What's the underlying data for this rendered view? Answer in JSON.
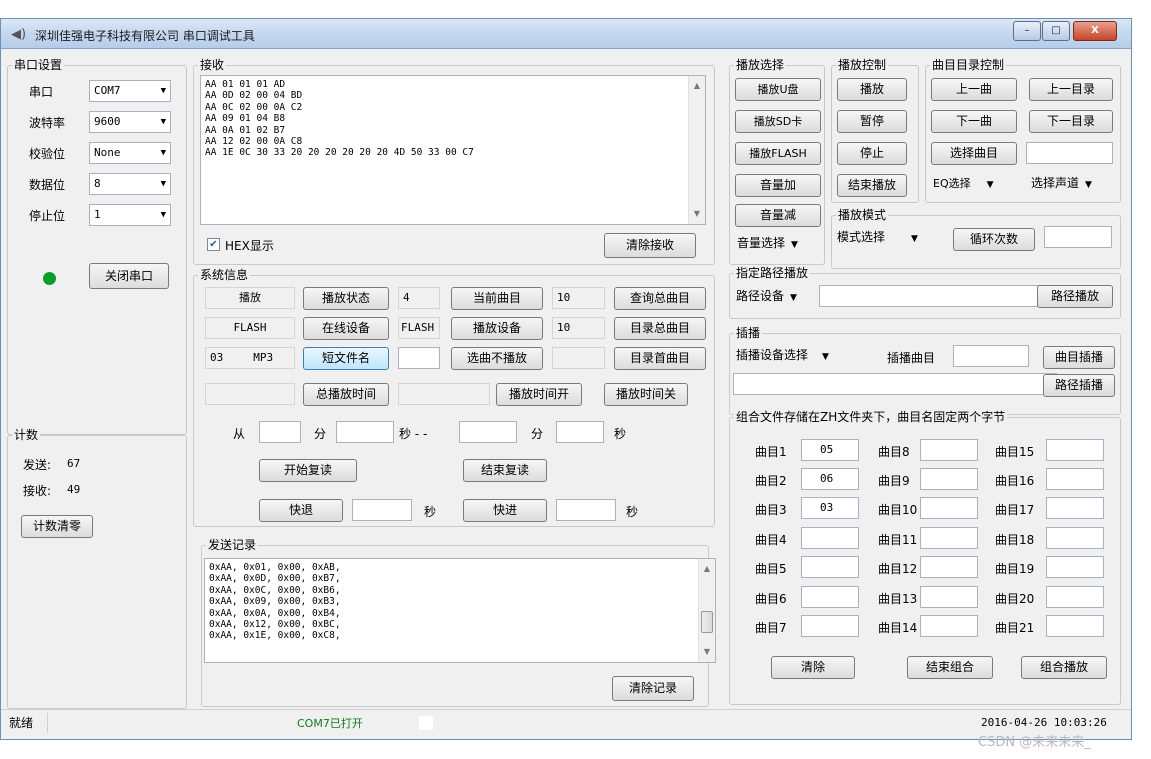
{
  "window": {
    "title": "深圳佳强电子科技有限公司  串口调试工具",
    "min": "–",
    "max": "□",
    "close": "X"
  },
  "serial": {
    "group": "串口设置",
    "port_label": "串口",
    "port_value": "COM7",
    "baud_label": "波特率",
    "baud_value": "9600",
    "parity_label": "校验位",
    "parity_value": "None",
    "data_label": "数据位",
    "data_value": "8",
    "stop_label": "停止位",
    "stop_value": "1",
    "led_color": "#0c9c2c",
    "close_button": "关闭串口"
  },
  "counter": {
    "group": "计数",
    "sent_label": "发送:",
    "sent_value": "67",
    "recv_label": "接收:",
    "recv_value": "49",
    "clear_button": "计数清零"
  },
  "receive": {
    "group": "接收",
    "lines": "AA 01 01 01 AD\nAA 0D 02 00 04 BD\nAA 0C 02 00 0A C2\nAA 09 01 04 B8\nAA 0A 01 02 B7\nAA 12 02 00 0A C8\nAA 1E 0C 30 33 20 20 20 20 20 20 4D 50 33 00 C7",
    "hex_label": "HEX显示",
    "hex_checked": "✔",
    "clear_button": "清除接收"
  },
  "sysinfo": {
    "group": "系统信息",
    "status_value": "播放",
    "status_button": "播放状态",
    "cur_track_value": "4",
    "cur_track_button": "当前曲目",
    "total_value": "10",
    "total_button": "查询总曲目",
    "online_value": "FLASH",
    "online_button": "在线设备",
    "play_dev_value": "FLASH",
    "play_dev_button": "播放设备",
    "dir_total_value": "10",
    "dir_total_button": "目录总曲目",
    "short_name_value_a": "03",
    "short_name_value_b": "MP3",
    "short_name_button": "短文件名",
    "no_play_value": "",
    "no_play_button": "选曲不播放",
    "dir_first_value": "",
    "dir_first_button": "目录首曲目",
    "total_time_value": "",
    "total_time_button": "总播放时间",
    "time_on_value": "",
    "time_on_button": "播放时间开",
    "time_off_button": "播放时间关",
    "from_label": "从",
    "min_label": "分",
    "sec_label": "秒 - -",
    "min2_label": "分",
    "sec2_label": "秒",
    "start_repeat": "开始复读",
    "end_repeat": "结束复读",
    "rewind": "快退",
    "rewind_sec": "秒",
    "forward": "快进",
    "forward_sec": "秒"
  },
  "sendlog": {
    "group": "发送记录",
    "lines": "0xAA, 0x01, 0x00, 0xAB,\n0xAA, 0x0D, 0x00, 0xB7,\n0xAA, 0x0C, 0x00, 0xB6,\n0xAA, 0x09, 0x00, 0xB3,\n0xAA, 0x0A, 0x00, 0xB4,\n0xAA, 0x12, 0x00, 0xBC,\n0xAA, 0x1E, 0x00, 0xC8,",
    "clear_button": "清除记录"
  },
  "play_select": {
    "group": "播放选择",
    "udisk": "播放U盘",
    "sd": "播放SD卡",
    "flash": "播放FLASH",
    "vol_up": "音量加",
    "vol_down": "音量减",
    "vol_select": "音量选择"
  },
  "play_ctrl": {
    "group": "播放控制",
    "play": "播放",
    "pause": "暂停",
    "stop": "停止",
    "end": "结束播放"
  },
  "dir_ctrl": {
    "group": "曲目目录控制",
    "prev": "上一曲",
    "prev_dir": "上一目录",
    "next": "下一曲",
    "next_dir": "下一目录",
    "select": "选择曲目",
    "select_value": "",
    "eq": "EQ选择",
    "channel": "选择声道"
  },
  "play_mode": {
    "group": "播放模式",
    "mode_select": "模式选择",
    "loop": "循环次数",
    "loop_value": ""
  },
  "path_play": {
    "group": "指定路径播放",
    "device": "路径设备",
    "path_value": "",
    "button": "路径播放"
  },
  "insert": {
    "group": "插播",
    "device": "插播设备选择",
    "track_label": "插播曲目",
    "track_value": "",
    "track_button": "曲目插播",
    "path_value": "",
    "path_button": "路径插播"
  },
  "combo": {
    "group": "组合文件存储在ZH文件夹下，曲目名固定两个字节",
    "col1": [
      {
        "label": "曲目1",
        "value": "05"
      },
      {
        "label": "曲目2",
        "value": "06"
      },
      {
        "label": "曲目3",
        "value": "03"
      },
      {
        "label": "曲目4",
        "value": ""
      },
      {
        "label": "曲目5",
        "value": ""
      },
      {
        "label": "曲目6",
        "value": ""
      },
      {
        "label": "曲目7",
        "value": ""
      }
    ],
    "col2": [
      {
        "label": "曲目8",
        "value": ""
      },
      {
        "label": "曲目9",
        "value": ""
      },
      {
        "label": "曲目10",
        "value": ""
      },
      {
        "label": "曲目11",
        "value": ""
      },
      {
        "label": "曲目12",
        "value": ""
      },
      {
        "label": "曲目13",
        "value": ""
      },
      {
        "label": "曲目14",
        "value": ""
      }
    ],
    "col3": [
      {
        "label": "曲目15",
        "value": ""
      },
      {
        "label": "曲目16",
        "value": ""
      },
      {
        "label": "曲目17",
        "value": ""
      },
      {
        "label": "曲目18",
        "value": ""
      },
      {
        "label": "曲目19",
        "value": ""
      },
      {
        "label": "曲目20",
        "value": ""
      },
      {
        "label": "曲目21",
        "value": ""
      }
    ],
    "clear": "清除",
    "end": "结束组合",
    "play": "组合播放"
  },
  "status": {
    "ready": "就绪",
    "port": "COM7已打开",
    "datetime": "2016-04-26 10:03:26"
  },
  "watermark": "CSDN @未来未来_"
}
